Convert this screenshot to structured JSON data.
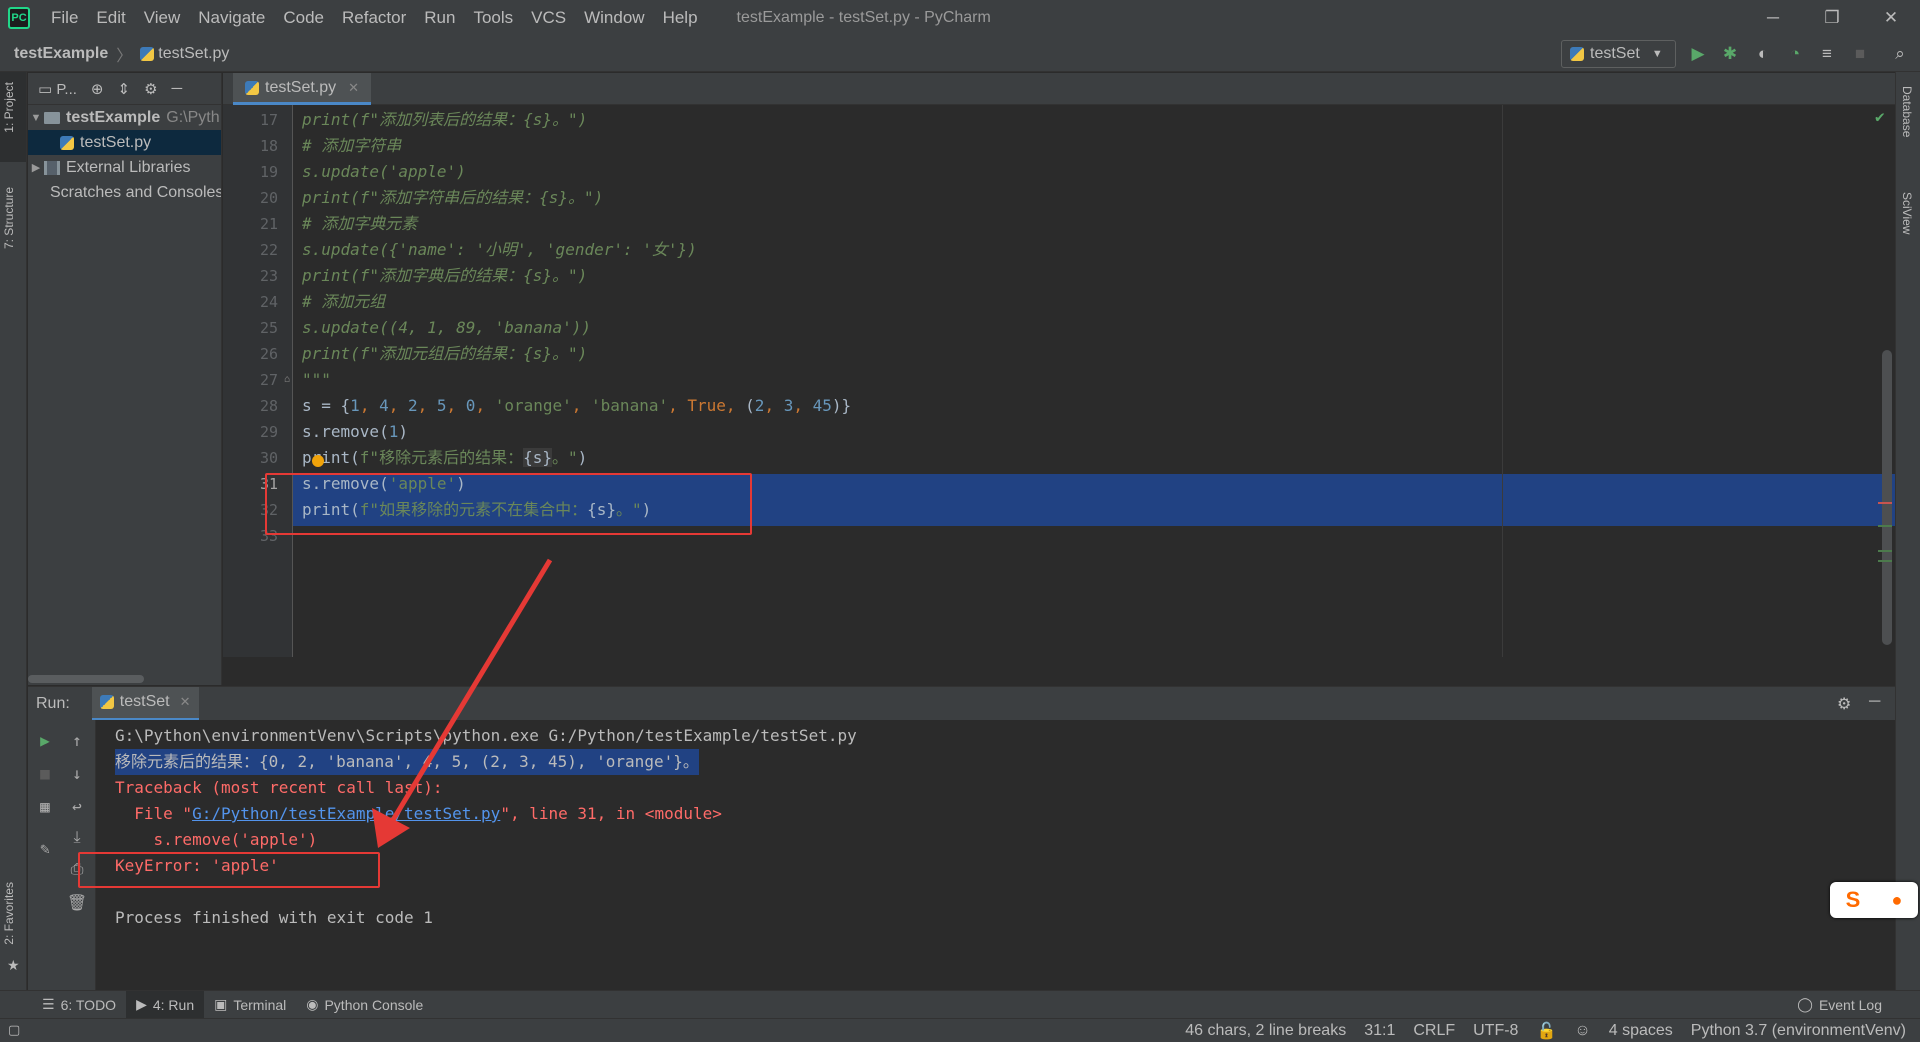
{
  "menubar": {
    "logo_text": "PC",
    "items": [
      "File",
      "Edit",
      "View",
      "Navigate",
      "Code",
      "Refactor",
      "Run",
      "Tools",
      "VCS",
      "Window",
      "Help"
    ],
    "window_title": "testExample - testSet.py - PyCharm",
    "minimize": "─",
    "restore": "❐",
    "close": "✕"
  },
  "navbar": {
    "project": "testExample",
    "separator": "〉",
    "file": "testSet.py",
    "run_config": "testSet"
  },
  "left_stripe": {
    "project": "1: Project",
    "structure": "7: Structure",
    "favorites": "2: Favorites"
  },
  "right_stripe": {
    "database": "Database",
    "sciview": "SciView"
  },
  "project_panel": {
    "header": "P...",
    "tree": [
      {
        "label": "testExample",
        "path_hint": "G:\\Pyth"
      },
      {
        "label": "testSet.py"
      },
      {
        "label": "External Libraries"
      },
      {
        "label": "Scratches and Consoles"
      }
    ]
  },
  "editor": {
    "tab_label": "testSet.py",
    "line_numbers": [
      "17",
      "18",
      "19",
      "20",
      "21",
      "22",
      "23",
      "24",
      "25",
      "26",
      "27",
      "28",
      "29",
      "30",
      "31",
      "32",
      "33"
    ]
  },
  "code": {
    "l17a": "print(f\"添加列表后的结果：{s}。\")",
    "l18": "# 添加字符串",
    "l19": "s.update('apple')",
    "l20": "print(f\"添加字符串后的结果：{s}。\")",
    "l21": "# 添加字典元素",
    "l22": "s.update({'name': '小明', 'gender': '女'})",
    "l23": "print(f\"添加字典后的结果：{s}。\")",
    "l24": "# 添加元组",
    "l25": "s.update((4, 1, 89, 'banana'))",
    "l26": "print(f\"添加元组后的结果：{s}。\")",
    "l27": "\"\"\"",
    "l28_var": "s",
    "l28_eq": " = {",
    "l28_n1": "1",
    "l28_n2": "4",
    "l28_n3": "2",
    "l28_n4": "5",
    "l28_n5": "0",
    "l28_s1": "'orange'",
    "l28_s2": "'banana'",
    "l28_kw": "True",
    "l28_t1": "2",
    "l28_t2": "3",
    "l28_t3": "45",
    "l29_pre": "s.remove(",
    "l29_num": "1",
    "l29_post": ")",
    "l30_pre": "print(",
    "l30_str": "f\"移除元素后的结果：",
    "l30_var": "{s}",
    "l30_end": "。\"",
    "l30_close": ")",
    "l31_pre": "s.remove(",
    "l31_str": "'apple'",
    "l31_post": ")",
    "l32_pre": "print(",
    "l32_str": "f\"如果移除的元素不在集合中：",
    "l32_var": "{s}",
    "l32_end": "。\"",
    "l32_close": ")"
  },
  "run": {
    "label": "Run:",
    "tab": "testSet",
    "out_cmd": "G:\\Python\\environmentVenv\\Scripts\\python.exe G:/Python/testExample/testSet.py",
    "out_result": "移除元素后的结果：{0, 2, 'banana', 4, 5, (2, 3, 45), 'orange'}。",
    "out_traceback": "Traceback (most recent call last):",
    "out_file_pre": "  File \"",
    "out_file_link": "G:/Python/testExample/testSet.py",
    "out_file_post": "\", line 31, in <module>",
    "out_code": "    s.remove('apple')",
    "out_error": "KeyError: 'apple'",
    "out_exit": "Process finished with exit code 1"
  },
  "bottom_tools": {
    "todo": "6: TODO",
    "run": "4: Run",
    "terminal": "Terminal",
    "python_console": "Python Console",
    "event_log": "Event Log"
  },
  "status": {
    "chars": "46 chars, 2 line breaks",
    "position": "31:1",
    "line_sep": "CRLF",
    "encoding": "UTF-8",
    "indent": "4 spaces",
    "interpreter": "Python 3.7 (environmentVenv)"
  },
  "ime": {
    "logo": "S"
  },
  "colors": {
    "annotation": "#e53935",
    "selection": "#214283",
    "error_text": "#ff6b68",
    "link": "#5394ec"
  }
}
